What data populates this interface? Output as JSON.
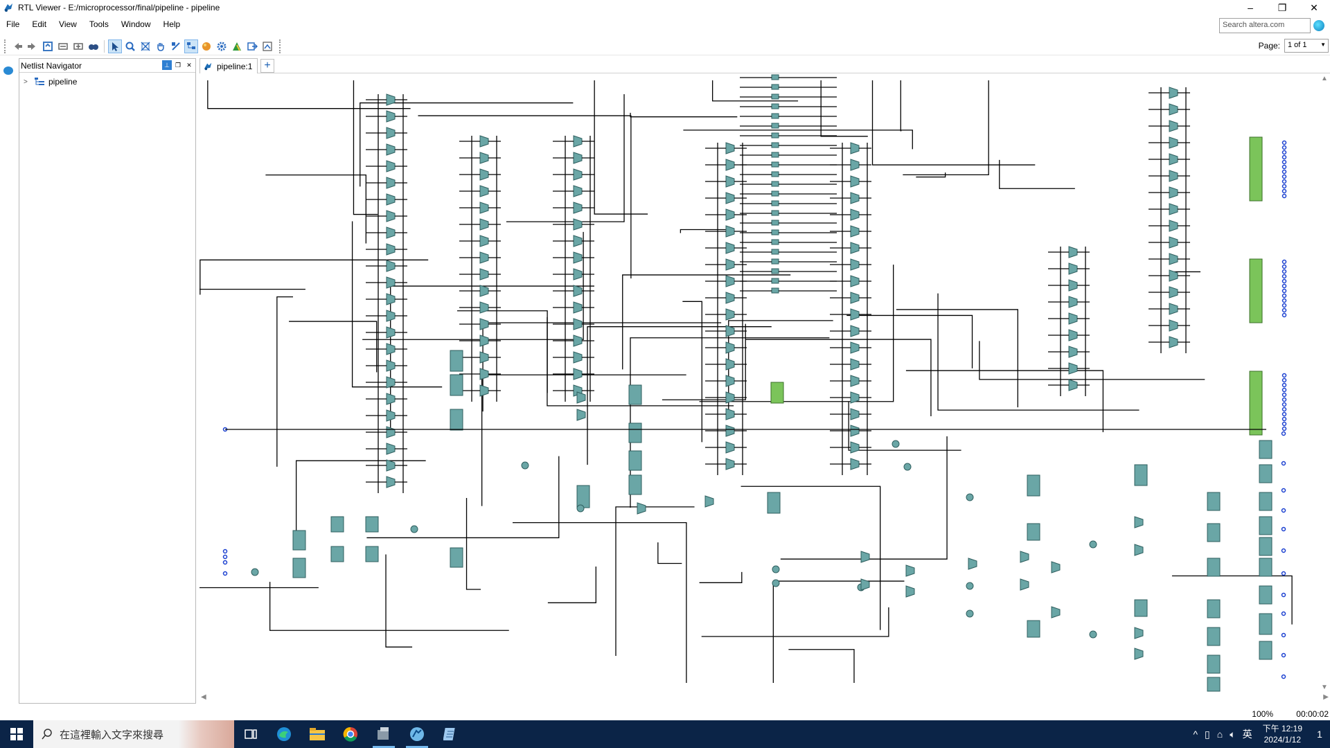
{
  "window": {
    "title": "RTL Viewer - E:/microprocessor/final/pipeline - pipeline",
    "minimize": "–",
    "restore": "❐",
    "close": "✕"
  },
  "menu": [
    "File",
    "Edit",
    "View",
    "Tools",
    "Window",
    "Help"
  ],
  "search": {
    "placeholder": "Search altera.com"
  },
  "page": {
    "label": "Page:",
    "value": "1 of 1"
  },
  "navigator": {
    "title": "Netlist Navigator",
    "tree": [
      {
        "label": "pipeline",
        "expander": ">"
      }
    ]
  },
  "tabs": [
    {
      "label": "pipeline:1"
    }
  ],
  "tab_add": "+",
  "status": {
    "zoom": "100%",
    "elapsed": "00:00:02"
  },
  "taskbar": {
    "search_placeholder": "在這裡輸入文字來搜尋",
    "time": "下午 12:19",
    "date": "2024/1/12",
    "ime": "英",
    "notification_count": "1"
  },
  "icons": {
    "title": "rtl-viewer-icon",
    "start": "windows-icon",
    "search": "magnifier-icon",
    "toolbar": [
      "back-icon",
      "forward-icon",
      "refresh-icon",
      "collapse-icon",
      "expand-icon",
      "find-icon",
      "select-icon",
      "zoom-icon",
      "fit-icon",
      "hand-icon",
      "net-icon",
      "hierarchy-icon",
      "color-icon",
      "settings-icon",
      "graph-icon",
      "export-icon",
      "filter-icon"
    ]
  },
  "colors": {
    "block": "#6aa6a6",
    "green_block": "#7bc45a",
    "wire": "#000000",
    "port": "#1a3fd0",
    "taskbar": "#0b2447",
    "accent": "#2e7fd2"
  }
}
